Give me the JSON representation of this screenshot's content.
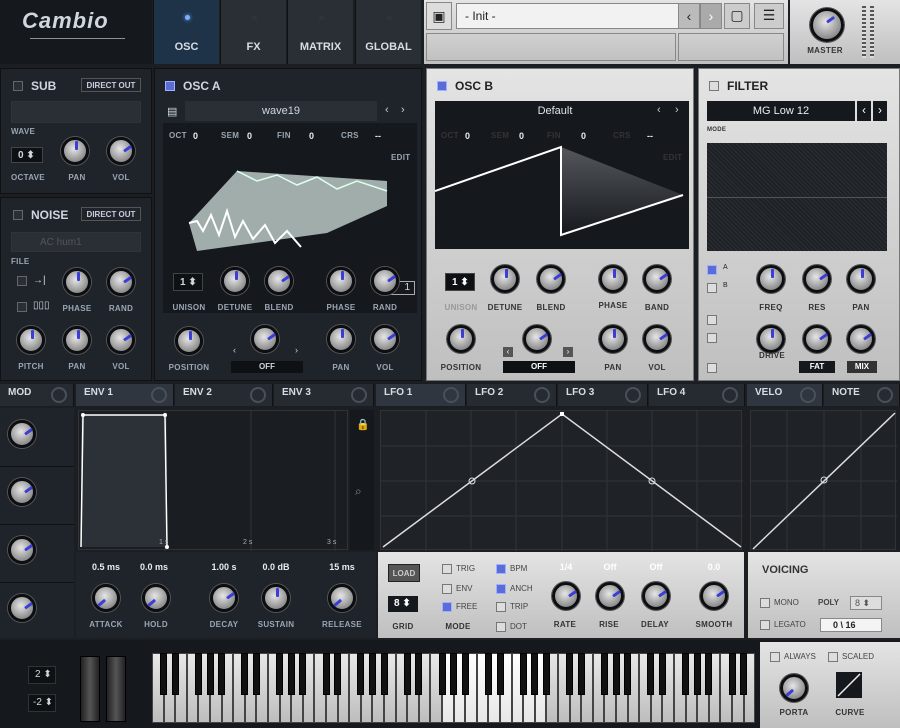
{
  "app": {
    "logo": "Cambio"
  },
  "tabs": [
    {
      "label": "OSC",
      "active": true
    },
    {
      "label": "FX"
    },
    {
      "label": "MATRIX"
    },
    {
      "label": "GLOBAL"
    }
  ],
  "preset": {
    "name": "- Init -"
  },
  "master": {
    "label": "MASTER"
  },
  "sub": {
    "title": "SUB",
    "direct_out": "DIRECT OUT",
    "wave_label": "WAVE",
    "octave_value": "0",
    "octave_label": "OCTAVE",
    "pan_label": "PAN",
    "vol_label": "VOL"
  },
  "noise": {
    "title": "NOISE",
    "direct_out": "DIRECT OUT",
    "preset": "AC hum1",
    "file_label": "FILE",
    "phase_label": "PHASE",
    "rand_label": "RAND",
    "pitch_label": "PITCH",
    "pan_label": "PAN",
    "vol_label": "VOL"
  },
  "osc_a": {
    "title": "OSC A",
    "wave": "wave19",
    "oct_label": "OCT",
    "oct": "0",
    "sem_label": "SEM",
    "sem": "0",
    "fin_label": "FIN",
    "fin": "0",
    "crs_label": "CRS",
    "crs": "--",
    "edit": "EDIT",
    "frame": "1",
    "unison": "1",
    "unison_label": "UNISON",
    "detune_label": "DETUNE",
    "blend_label": "BLEND",
    "phase_label": "PHASE",
    "rand_label": "RAND",
    "position_label": "POSITION",
    "mode": "OFF",
    "pan_label": "PAN",
    "vol_label": "VOL"
  },
  "osc_b": {
    "title": "OSC B",
    "wave": "Default",
    "oct_label": "OCT",
    "oct": "0",
    "sem_label": "SEM",
    "sem": "0",
    "fin_label": "FIN",
    "fin": "0",
    "crs_label": "CRS",
    "crs": "--",
    "edit": "EDIT",
    "unison": "1",
    "unison_label": "UNISON",
    "detune_label": "DETUNE",
    "blend_label": "BLEND",
    "phase_label": "PHASE",
    "band_label": "BAND",
    "position_label": "POSITION",
    "mode": "OFF",
    "pan_label": "PAN",
    "vol_label": "VOL"
  },
  "filter": {
    "title": "FILTER",
    "type": "MG Low 12",
    "mode_label": "MODE",
    "a_label": "A",
    "b_label": "B",
    "freq_label": "FREQ",
    "res_label": "RES",
    "pan_label": "PAN",
    "drive_label": "DRIVE",
    "fat": "FAT",
    "mix": "MIX"
  },
  "mod_tabs": [
    {
      "label": "MOD"
    },
    {
      "label": "ENV 1",
      "active": true
    },
    {
      "label": "ENV 2"
    },
    {
      "label": "ENV 3"
    },
    {
      "label": "LFO 1",
      "active": true
    },
    {
      "label": "LFO 2"
    },
    {
      "label": "LFO 3"
    },
    {
      "label": "LFO 4"
    },
    {
      "label": "VELO",
      "active": true
    },
    {
      "label": "NOTE"
    }
  ],
  "env": {
    "t1": "1 s",
    "t2": "2 s",
    "t3": "3 s",
    "attack": "0.5 ms",
    "attack_label": "ATTACK",
    "hold": "0.0 ms",
    "hold_label": "HOLD",
    "decay": "1.00 s",
    "decay_label": "DECAY",
    "sustain": "0.0 dB",
    "sustain_label": "SUSTAIN",
    "release": "15 ms",
    "release_label": "RELEASE"
  },
  "lfo": {
    "load": "LOAD",
    "grid": "8",
    "grid_label": "GRID",
    "mode_label": "MODE",
    "trig": "TRIG",
    "env": "ENV",
    "free": "FREE",
    "bpm": "BPM",
    "anch": "ANCH",
    "trip": "TRIP",
    "dot": "DOT",
    "rate": "1/4",
    "rate_label": "RATE",
    "rise": "Off",
    "rise_label": "RISE",
    "delay": "Off",
    "delay_label": "DELAY",
    "smooth": "0.0",
    "smooth_label": "SMOOTH"
  },
  "voicing": {
    "title": "VOICING",
    "mono": "MONO",
    "poly_label": "POLY",
    "poly": "8",
    "legato": "LEGATO",
    "voices": "0",
    "max": "16",
    "always": "ALWAYS",
    "scaled": "SCALED",
    "porta": "PORTA",
    "curve": "CURVE"
  },
  "keyboard": {
    "bend_up": "2",
    "bend_down": "-2"
  }
}
